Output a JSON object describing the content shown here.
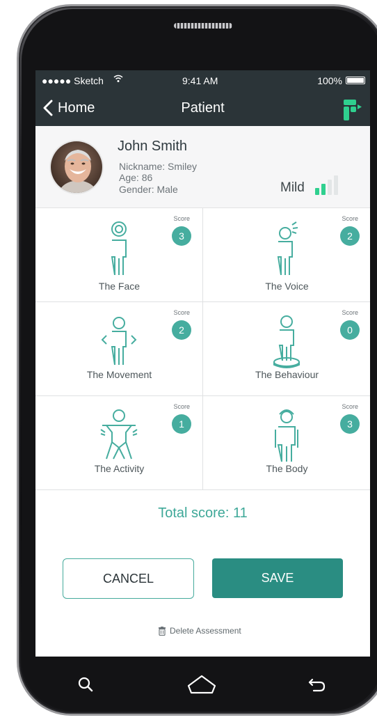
{
  "status_bar": {
    "carrier": "●●●●● Sketch",
    "time": "9:41 AM",
    "battery": "100%",
    "wifi_icon": "wifi-icon",
    "battery_icon": "battery-icon"
  },
  "nav": {
    "back_label": "Home",
    "back_icon": "chevron-left-icon",
    "title": "Patient",
    "logo_icon": "app-logo-icon"
  },
  "patient": {
    "name": "John Smith",
    "nickname": "Nickname: Smiley",
    "age": "Age: 86",
    "gender": "Gender: Male",
    "severity": "Mild",
    "severity_level": 2,
    "severity_max": 4
  },
  "categories": [
    {
      "label": "The Face",
      "score_label": "Score",
      "score": "3",
      "icon": "face-figure-icon"
    },
    {
      "label": "The Voice",
      "score_label": "Score",
      "score": "2",
      "icon": "voice-figure-icon"
    },
    {
      "label": "The Movement",
      "score_label": "Score",
      "score": "2",
      "icon": "movement-figure-icon"
    },
    {
      "label": "The Behaviour",
      "score_label": "Score",
      "score": "0",
      "icon": "behaviour-figure-icon"
    },
    {
      "label": "The Activity",
      "score_label": "Score",
      "score": "1",
      "icon": "activity-figure-icon"
    },
    {
      "label": "The Body",
      "score_label": "Score",
      "score": "3",
      "icon": "body-figure-icon"
    }
  ],
  "total": "Total score: 11",
  "actions": {
    "cancel": "CANCEL",
    "save": "SAVE",
    "delete": "Delete Assessment"
  },
  "hardware_nav": {
    "search_icon": "search-icon",
    "home_icon": "home-icon",
    "back_icon": "back-arrow-icon"
  },
  "colors": {
    "accent": "#46ad9f",
    "save": "#2a8d82",
    "header": "#2b3438",
    "logo": "#2fd08f"
  }
}
